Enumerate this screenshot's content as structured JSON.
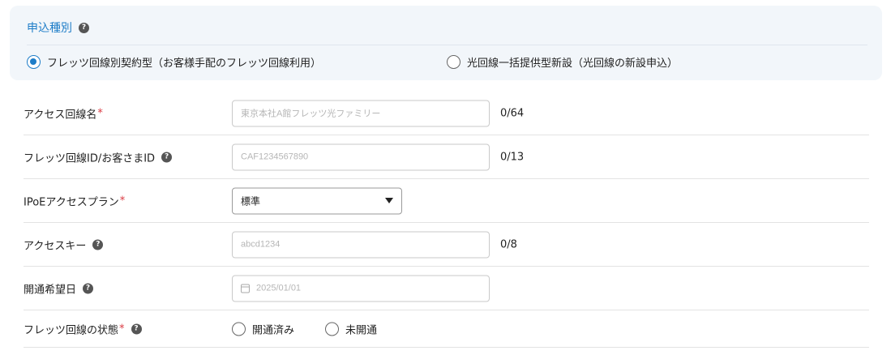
{
  "application_type": {
    "title": "申込種別",
    "options": [
      {
        "label": "フレッツ回線別契約型（お客様手配のフレッツ回線利用）",
        "selected": true
      },
      {
        "label": "光回線一括提供型新設（光回線の新設申込）",
        "selected": false
      }
    ]
  },
  "form": {
    "access_line_name": {
      "label": "アクセス回線名",
      "required_mark": "*",
      "placeholder": "東京本社A館フレッツ光ファミリー",
      "counter": "0/64"
    },
    "flets_id": {
      "label": "フレッツ回線ID/お客さまID",
      "placeholder": "CAF1234567890",
      "counter": "0/13"
    },
    "ipoe_plan": {
      "label": "IPoEアクセスプラン",
      "required_mark": "*",
      "value": "標準"
    },
    "access_key": {
      "label": "アクセスキー",
      "placeholder": "abcd1234",
      "counter": "0/8"
    },
    "open_date": {
      "label": "開通希望日",
      "placeholder": "2025/01/01"
    },
    "line_status": {
      "label": "フレッツ回線の状態",
      "required_mark": "*",
      "options": [
        "開通済み",
        "未開通"
      ]
    }
  },
  "colors": {
    "accent": "#1e7dc8",
    "required": "#d9363e",
    "panel_bg": "#f2f6fa"
  },
  "icons": {
    "help": "help-circle-icon",
    "calendar": "calendar-icon",
    "dropdown": "caret-down-icon"
  }
}
